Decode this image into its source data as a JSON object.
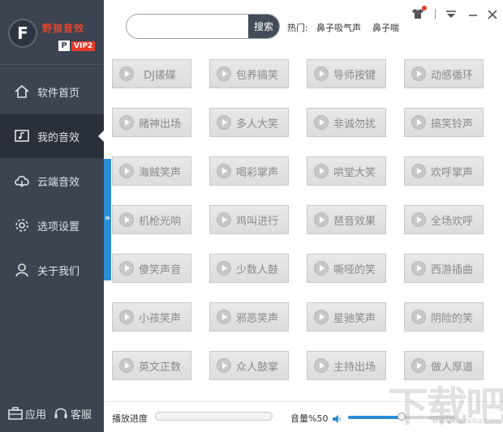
{
  "brand": {
    "logo_letter": "F",
    "name": "野狼音效",
    "vip_p": "P",
    "vip_label": "VIP2"
  },
  "sidebar": {
    "items": [
      {
        "label": "软件首页",
        "icon": "home-icon"
      },
      {
        "label": "我的音效",
        "icon": "music-icon",
        "active": true
      },
      {
        "label": "云端音效",
        "icon": "cloud-icon"
      },
      {
        "label": "选项设置",
        "icon": "gear-icon"
      },
      {
        "label": "关于我们",
        "icon": "user-icon"
      }
    ],
    "expand_arrow": "»",
    "bottom": {
      "apps_label": "应用",
      "service_label": "客服"
    }
  },
  "header": {
    "search_placeholder": "",
    "search_value": "",
    "search_button": "搜索",
    "hot_label": "热门:",
    "hot_items": [
      "鼻子吸气声",
      "鼻子喘"
    ]
  },
  "sounds": [
    "DJ搓碟",
    "包养搞笑",
    "导师按键",
    "动感循环",
    "赌神出场",
    "多人大笑",
    "非诚勿扰",
    "搞笑铃声",
    "海贼笑声",
    "喝彩掌声",
    "哄堂大笑",
    "欢呼掌声",
    "机枪光响",
    "鸡叫进行",
    "琶音效果",
    "全场欢呼",
    "傻笑声音",
    "少数人鼓",
    "嘶哑的笑",
    "西游插曲",
    "小孩笑声",
    "邪恶笑声",
    "星驰笑声",
    "阴险的笑",
    "英文正数",
    "众人鼓掌",
    "主持出场",
    "做人厚道"
  ],
  "footer": {
    "progress_label": "播放进度",
    "progress": 0,
    "volume_label": "音量%50",
    "volume": 0.5
  },
  "watermark": {
    "text": "下载吧",
    "url": "www.xiazaiba.com"
  },
  "colors": {
    "sidebar_bg": "#3b4450",
    "sidebar_active": "#2a3039",
    "accent": "#2a8cd6",
    "brand_red": "#e83a2a"
  }
}
